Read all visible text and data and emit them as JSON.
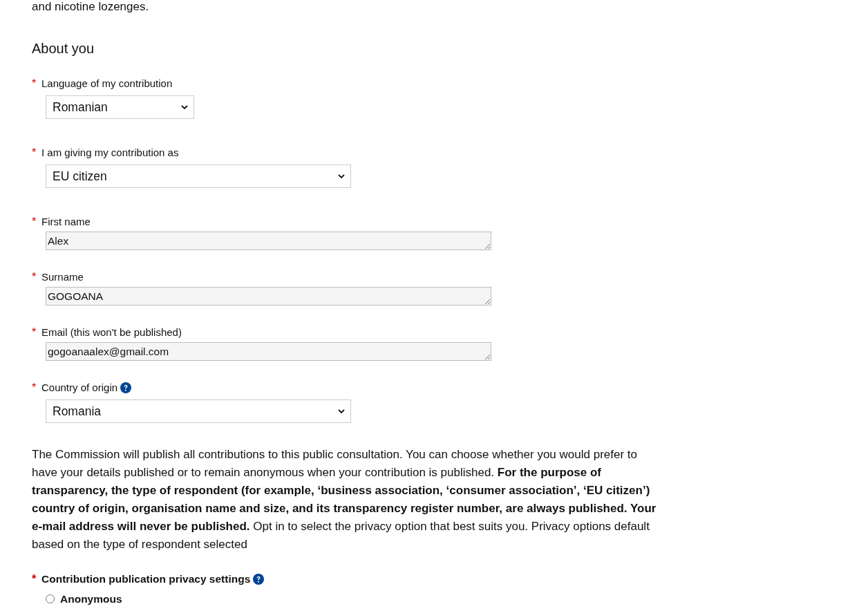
{
  "intro_tail": "and nicotine lozenges.",
  "section_title": "About you",
  "fields": [
    {
      "kind": "select",
      "marker": "*",
      "label": "Language of my contribution",
      "value": "Romanian"
    },
    {
      "kind": "select",
      "marker": "*",
      "label": "I am giving my contribution as",
      "value": "EU citizen"
    },
    {
      "kind": "text",
      "marker": "*",
      "label": "First name",
      "value": "Alex"
    },
    {
      "kind": "text",
      "marker": "*",
      "label": "Surname",
      "value": "GOGOANA"
    },
    {
      "kind": "text",
      "marker": "*",
      "label": "Email (this won't be published)",
      "value": "gogoanaalex@gmail.com"
    },
    {
      "kind": "select",
      "marker": "*",
      "label": "Country of origin",
      "help": true,
      "value": "Romania"
    }
  ],
  "notice": "The Commission will publish all contributions to this public consultation. You can choose whether you would prefer to have your details published or to remain anonymous when your contribution is published. **For the purpose of transparency, the type of respondent (for example, ‘business association, ‘consumer association’, ‘EU citizen’) country of origin, organisation name and size, and its transparency register number, are always published. Your e-mail address will never be published.** Opt in to select the privacy option that best suits you. Privacy options default based on the type of respondent selected",
  "privacy": {
    "marker": "*",
    "label": "Contribution publication privacy settings",
    "help": true,
    "options": [
      {
        "label": "Anonymous",
        "selected": false
      }
    ]
  }
}
